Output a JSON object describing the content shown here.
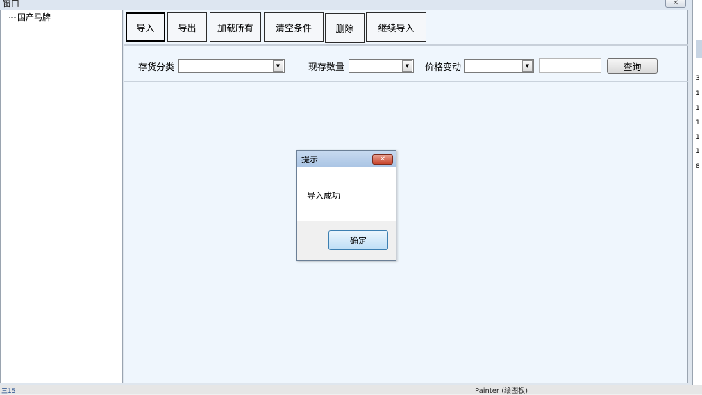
{
  "window": {
    "title": "窗口",
    "close_glyph": "✕"
  },
  "tree": {
    "root_label": "国产马牌"
  },
  "toolbar": {
    "import_label": "导入",
    "export_label": "导出",
    "load_all_label": "加载所有",
    "clear_filters_label": "清空条件",
    "delete_label": "删除",
    "continue_import_label": "继续导入"
  },
  "filters": {
    "category_label": "存货分类",
    "category_value": "",
    "quantity_label": "现存数量",
    "quantity_value": "",
    "price_change_label": "价格变动",
    "price_change_value": "",
    "price_value": "",
    "query_label": "查询"
  },
  "dialog": {
    "title": "提示",
    "message": "导入成功",
    "ok_label": "确定",
    "close_glyph": "✕"
  },
  "background_window": {
    "cells": [
      "3",
      "1",
      "1",
      "1",
      "1",
      "1",
      "8"
    ],
    "status_left": "三15",
    "status_text": "Painter (绘图板)"
  }
}
